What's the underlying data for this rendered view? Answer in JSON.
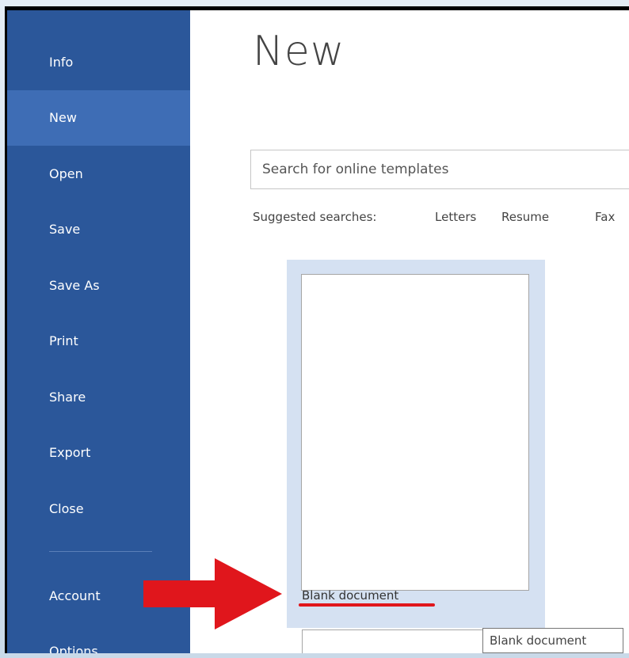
{
  "sidebar": {
    "items": [
      {
        "label": "Info"
      },
      {
        "label": "New",
        "active": true
      },
      {
        "label": "Open"
      },
      {
        "label": "Save"
      },
      {
        "label": "Save As"
      },
      {
        "label": "Print"
      },
      {
        "label": "Share"
      },
      {
        "label": "Export"
      },
      {
        "label": "Close"
      },
      {
        "label": "Account"
      },
      {
        "label": "Options"
      }
    ]
  },
  "main": {
    "title": "New",
    "search": {
      "placeholder": "Search for online templates"
    },
    "suggested": {
      "label": "Suggested searches:",
      "links": [
        "Letters",
        "Resume",
        "Fax"
      ]
    },
    "templates": [
      {
        "label": "Blank document"
      }
    ],
    "tooltip": "Blank document"
  },
  "annotation": {
    "arrow_icon": "red-arrow-right-icon",
    "arrow_color": "#e0161c"
  },
  "colors": {
    "sidebar_bg": "#2b579a",
    "sidebar_active": "#3e6db5",
    "tile_highlight": "#d5e1f2"
  }
}
